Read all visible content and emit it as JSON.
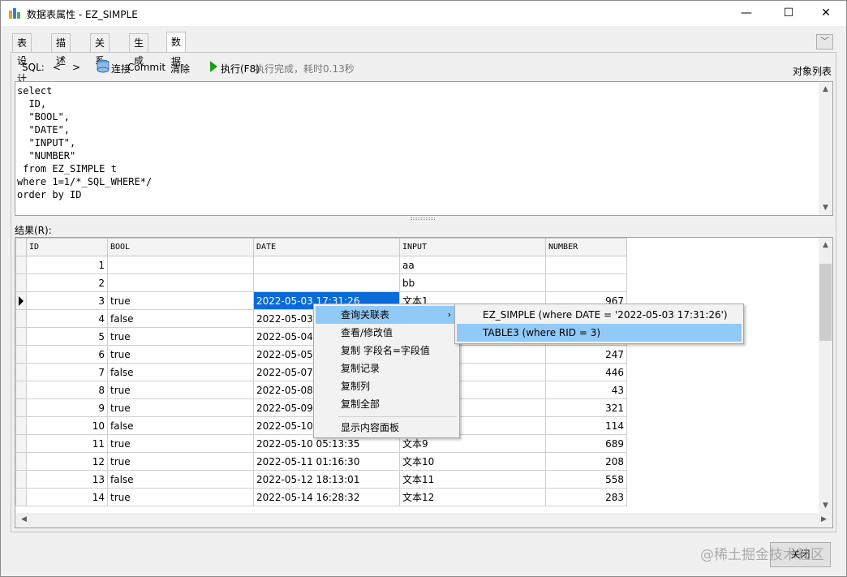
{
  "window": {
    "title": "数据表属性 - EZ_SIMPLE",
    "minimize": "—",
    "maximize": "☐",
    "close": "✕"
  },
  "tabs": [
    "表设计",
    "描述",
    "关系",
    "生成",
    "数据"
  ],
  "active_tab": "数据",
  "toolbar": {
    "sql_label": "SQL:",
    "prev": "<",
    "next": ">",
    "connect": "连接",
    "commit": "Commit",
    "clear": "清除",
    "execute": "执行(F8)",
    "status": "执行完成，耗时0.13秒",
    "object_list": "对象列表"
  },
  "sql_text": "select\n  ID,\n  \"BOOL\",\n  \"DATE\",\n  \"INPUT\",\n  \"NUMBER\"\n from EZ_SIMPLE t\nwhere 1=1/*_SQL_WHERE*/\norder by ID",
  "results_label": "结果(R):",
  "grid": {
    "columns": [
      "ID",
      "BOOL",
      "DATE",
      "INPUT",
      "NUMBER"
    ],
    "rows": [
      [
        "1",
        "",
        "",
        "aa",
        ""
      ],
      [
        "2",
        "",
        "",
        "bb",
        ""
      ],
      [
        "3",
        "true",
        "2022-05-03 17:31:26",
        "文本1",
        "967"
      ],
      [
        "4",
        "false",
        "2022-05-03",
        "",
        ""
      ],
      [
        "5",
        "true",
        "2022-05-04",
        "",
        ""
      ],
      [
        "6",
        "true",
        "2022-05-05",
        "",
        "247"
      ],
      [
        "7",
        "false",
        "2022-05-07",
        "",
        "446"
      ],
      [
        "8",
        "true",
        "2022-05-08",
        "",
        "43"
      ],
      [
        "9",
        "true",
        "2022-05-09",
        "",
        "321"
      ],
      [
        "10",
        "false",
        "2022-05-10",
        "",
        "114"
      ],
      [
        "11",
        "true",
        "2022-05-10 05:13:35",
        "文本9",
        "689"
      ],
      [
        "12",
        "true",
        "2022-05-11 01:16:30",
        "文本10",
        "208"
      ],
      [
        "13",
        "false",
        "2022-05-12 18:13:01",
        "文本11",
        "558"
      ],
      [
        "14",
        "true",
        "2022-05-14 16:28:32",
        "文本12",
        "283"
      ]
    ]
  },
  "context_menu": {
    "items": [
      "查询关联表",
      "查看/修改值",
      "复制 字段名=字段值",
      "复制记录",
      "复制列",
      "复制全部",
      "显示内容面板"
    ],
    "submenu_arrow": "›",
    "submenu": [
      "EZ_SIMPLE (where DATE = '2022-05-03 17:31:26')",
      "TABLE3 (where RID = 3)"
    ]
  },
  "close_button": "关闭",
  "watermark": "@稀土掘金技术社区"
}
